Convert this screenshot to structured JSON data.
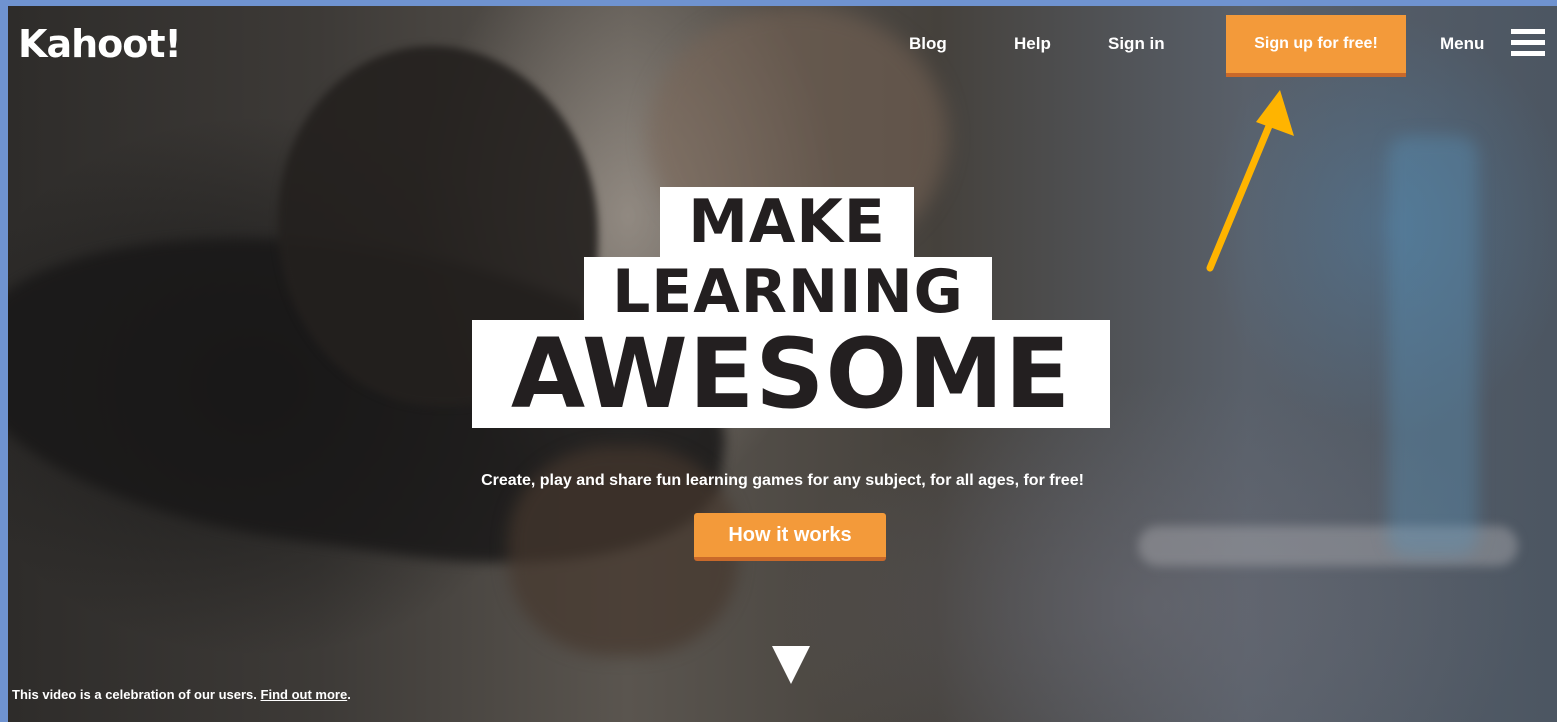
{
  "header": {
    "logo_text": "Kahoot!",
    "nav": {
      "blog": "Blog",
      "help": "Help",
      "sign_in": "Sign in",
      "sign_up": "Sign up for free!",
      "menu": "Menu"
    }
  },
  "hero": {
    "line1": "MAKE",
    "line2": "LEARNING",
    "line3": "AWESOME",
    "tagline": "Create, play and share fun learning games for any subject, for all ages, for free!",
    "cta": "How it works"
  },
  "footer_caption": {
    "text": "This video is a celebration of our users.",
    "link": "Find out more",
    "suffix": "."
  },
  "colors": {
    "accent": "#f39a3a",
    "annotation_arrow": "#ffb400",
    "frame_border": "#6f93d0"
  },
  "icons": {
    "menu": "hamburger-icon",
    "scroll": "triangle-down-icon",
    "annotation": "arrow-up-right-icon"
  }
}
